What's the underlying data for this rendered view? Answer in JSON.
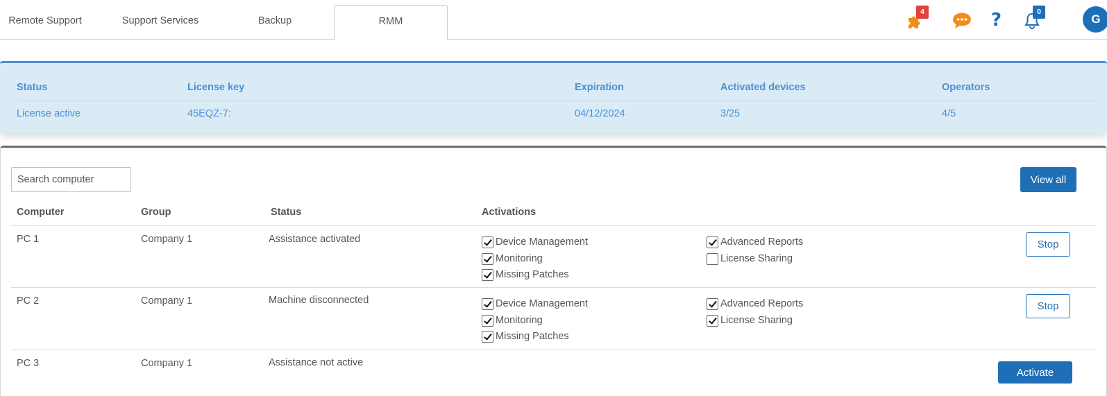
{
  "nav": {
    "tabs": [
      {
        "label": "Remote Support"
      },
      {
        "label": "Support Services"
      },
      {
        "label": "Backup"
      },
      {
        "label": "RMM",
        "active": true
      }
    ],
    "icons": {
      "puzzle_badge": "4",
      "notifications_badge": "0",
      "avatar_initial": "G"
    }
  },
  "license": {
    "headers": {
      "status": "Status",
      "key": "License key",
      "expiration": "Expiration",
      "devices": "Activated devices",
      "operators": "Operators"
    },
    "values": {
      "status": "License active",
      "key": "45EQZ-7:",
      "expiration": "04/12/2024",
      "devices": "3/25",
      "operators": "4/5"
    }
  },
  "computers": {
    "search_placeholder": "Search computer",
    "view_all_label": "View all",
    "columns": {
      "computer": "Computer",
      "group": "Group",
      "status": "Status",
      "activations": "Activations"
    },
    "rows": [
      {
        "name": "PC 1",
        "group": "Company 1",
        "status": "Assistance activated",
        "activations": [
          {
            "label": "Device Management",
            "checked": true
          },
          {
            "label": "Monitoring",
            "checked": true
          },
          {
            "label": "Missing Patches",
            "checked": true
          },
          {
            "label": "Advanced Reports",
            "checked": true
          },
          {
            "label": "License Sharing",
            "checked": false
          }
        ],
        "action": "Stop"
      },
      {
        "name": "PC 2",
        "group": "Company 1",
        "status": "Machine disconnected",
        "activations": [
          {
            "label": "Device Management",
            "checked": true
          },
          {
            "label": "Monitoring",
            "checked": true
          },
          {
            "label": "Missing Patches",
            "checked": true
          },
          {
            "label": "Advanced Reports",
            "checked": true
          },
          {
            "label": "License Sharing",
            "checked": true
          }
        ],
        "action": "Stop"
      },
      {
        "name": "PC 3",
        "group": "Company 1",
        "status": "Assistance not active",
        "activations": [],
        "action": "Activate"
      }
    ]
  },
  "colors": {
    "accent": "#1f6fb6",
    "license_bg": "#daebf6",
    "license_text": "#4a90d6",
    "puzzle_icon": "#f28c1b",
    "chat_icon": "#f28c1b",
    "puzzle_badge": "#e0423a",
    "bell_badge": "#1f6fb6"
  }
}
